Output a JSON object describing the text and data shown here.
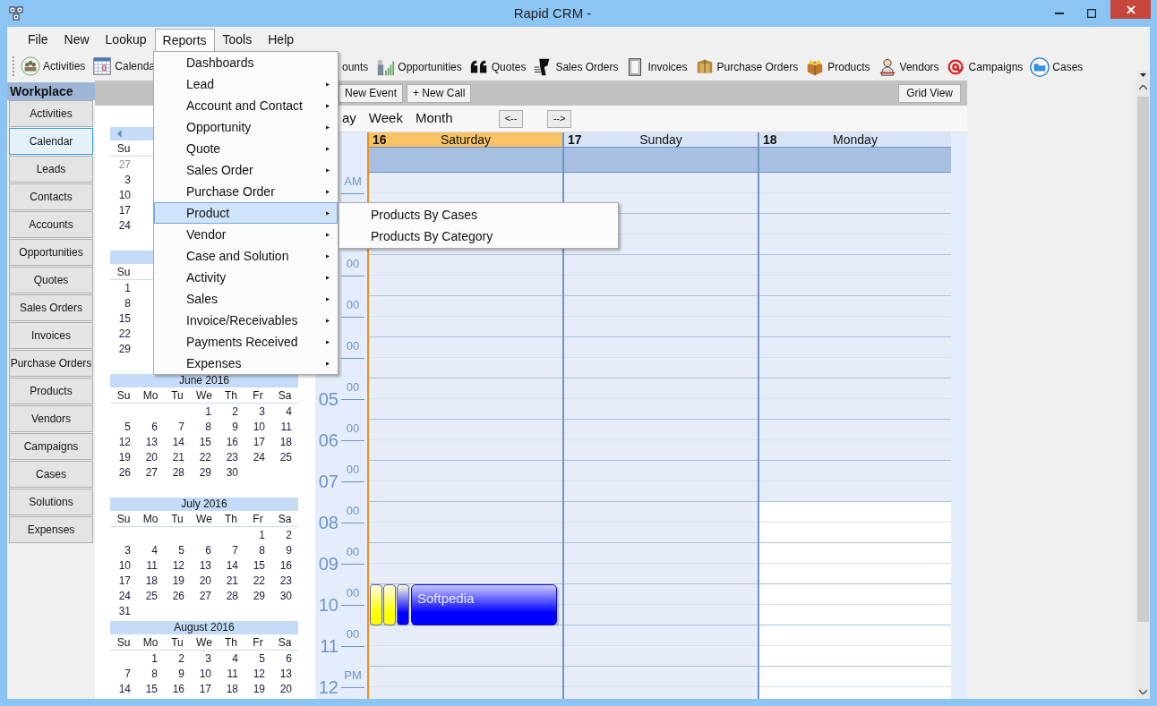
{
  "window": {
    "title": "Rapid CRM -"
  },
  "menu_bar": [
    {
      "label": "File",
      "selected": false
    },
    {
      "label": "New",
      "selected": false
    },
    {
      "label": "Lookup",
      "selected": false
    },
    {
      "label": "Reports",
      "selected": true
    },
    {
      "label": "Tools",
      "selected": false
    },
    {
      "label": "Help",
      "selected": false
    }
  ],
  "toolbar_left": [
    {
      "label": "Activities"
    },
    {
      "label": "Calenda"
    }
  ],
  "toolbar_right": [
    {
      "label": "ounts"
    },
    {
      "label": "Opportunities"
    },
    {
      "label": "Quotes"
    },
    {
      "label": "Sales Orders"
    },
    {
      "label": "Invoices"
    },
    {
      "label": "Purchase Orders"
    },
    {
      "label": "Products"
    },
    {
      "label": "Vendors"
    },
    {
      "label": "Campaigns"
    },
    {
      "label": "Cases"
    }
  ],
  "workplace": {
    "title": "Workplace",
    "items": [
      {
        "label": "Activities",
        "selected": false
      },
      {
        "label": "Calendar",
        "selected": true
      },
      {
        "label": "Leads",
        "selected": false
      },
      {
        "label": "Contacts",
        "selected": false
      },
      {
        "label": "Accounts",
        "selected": false
      },
      {
        "label": "Opportunities",
        "selected": false
      },
      {
        "label": "Quotes",
        "selected": false
      },
      {
        "label": "Sales Orders",
        "selected": false
      },
      {
        "label": "Invoices",
        "selected": false
      },
      {
        "label": "Purchase Orders",
        "selected": false
      },
      {
        "label": "Products",
        "selected": false
      },
      {
        "label": "Vendors",
        "selected": false
      },
      {
        "label": "Campaigns",
        "selected": false
      },
      {
        "label": "Cases",
        "selected": false
      },
      {
        "label": "Solutions",
        "selected": false
      },
      {
        "label": "Expenses",
        "selected": false
      }
    ]
  },
  "calendar_toolbar": {
    "buttons": [
      "New Event",
      "+ New Call"
    ],
    "grid_view": "Grid View"
  },
  "view_tabs": [
    "ay",
    "Week",
    "Month"
  ],
  "nav_buttons": [
    "<--",
    "-->"
  ],
  "mini_calendars": [
    {
      "prev_arrow": true,
      "weekdays": [
        "Su"
      ],
      "weeks": [
        [
          {
            "day": "27",
            "faded": true
          }
        ],
        [
          "3"
        ],
        [
          "10"
        ],
        [
          "17"
        ],
        [
          "24"
        ]
      ]
    },
    {
      "prev_arrow": false,
      "weekdays": [
        "Su"
      ],
      "weeks": [
        [
          "1"
        ],
        [
          "8"
        ],
        [
          "15"
        ],
        [
          "22"
        ],
        [
          "29"
        ]
      ]
    },
    {
      "prev_arrow": false,
      "title": "June 2016",
      "weekdays": [
        "Su",
        "Mo",
        "Tu",
        "We",
        "Th",
        "Fr",
        "Sa"
      ],
      "weeks": [
        [
          "1",
          "2",
          "3",
          "4"
        ],
        [
          "5",
          "6",
          "7",
          "8",
          "9",
          "10",
          "11"
        ],
        [
          "12",
          "13",
          "14",
          "15",
          "16",
          "17",
          "18"
        ],
        [
          "19",
          "20",
          "21",
          "22",
          "23",
          "24",
          "25"
        ],
        [
          "26",
          "27",
          "28",
          "29",
          "30"
        ]
      ]
    },
    {
      "prev_arrow": false,
      "title": "July 2016",
      "weekdays": [
        "Su",
        "Mo",
        "Tu",
        "We",
        "Th",
        "Fr",
        "Sa"
      ],
      "weeks": [
        [
          "1",
          "2"
        ],
        [
          "3",
          "4",
          "5",
          "6",
          "7",
          "8",
          "9"
        ],
        [
          "10",
          "11",
          "12",
          "13",
          "14",
          "15",
          "16"
        ],
        [
          "17",
          "18",
          "19",
          "20",
          "21",
          "22",
          "23"
        ],
        [
          "24",
          "25",
          "26",
          "27",
          "28",
          "29",
          "30"
        ],
        [
          "31"
        ]
      ]
    },
    {
      "prev_arrow": false,
      "title": "August 2016",
      "weekdays": [
        "Su",
        "Mo",
        "Tu",
        "We",
        "Th",
        "Fr",
        "Sa"
      ],
      "weeks": [
        [
          "1",
          "2",
          "3",
          "4",
          "5",
          "6"
        ],
        [
          "7",
          "8",
          "9",
          "10",
          "11",
          "12",
          "13"
        ],
        [
          "14",
          "15",
          "16",
          "17",
          "18",
          "19",
          "20"
        ]
      ]
    }
  ],
  "days": [
    {
      "number": "16",
      "name": "Saturday",
      "selected": true,
      "weekend": true
    },
    {
      "number": "17",
      "name": "Sunday",
      "selected": false,
      "weekend": true
    },
    {
      "number": "18",
      "name": "Monday",
      "selected": false,
      "weekend": false
    }
  ],
  "time_rows": [
    {
      "minor": "AM",
      "work": false
    },
    {
      "work": false
    },
    {
      "minor": "00",
      "work": false
    },
    {
      "minor": "00",
      "work": false
    },
    {
      "minor": "00",
      "work": false
    },
    {
      "hour": "05",
      "minor": "00",
      "work": false
    },
    {
      "hour": "06",
      "minor": "00",
      "work": false
    },
    {
      "hour": "07",
      "minor": "00",
      "work": false
    },
    {
      "hour": "08",
      "minor": "00",
      "work": true
    },
    {
      "hour": "09",
      "minor": "00",
      "work": true
    },
    {
      "hour": "10",
      "minor": "00",
      "work": true,
      "cells": [
        {
          "events": [
            {
              "kind": "marker",
              "color": "#ffff00"
            },
            {
              "kind": "marker",
              "color": "#ffff00"
            },
            {
              "kind": "marker",
              "color": "#0000ff"
            },
            {
              "kind": "appointment",
              "title": "Softpedia",
              "color": "#0000ff"
            }
          ]
        }
      ]
    },
    {
      "hour": "11",
      "minor": "00",
      "work": true
    },
    {
      "hour": "12",
      "minor": "PM",
      "work": true
    }
  ],
  "reports_menu": {
    "items": [
      {
        "label": "Dashboards",
        "submenu": false,
        "selected": false
      },
      {
        "label": "Lead",
        "submenu": true,
        "selected": false
      },
      {
        "label": "Account and Contact",
        "submenu": true,
        "selected": false
      },
      {
        "label": "Opportunity",
        "submenu": true,
        "selected": false
      },
      {
        "label": "Quote",
        "submenu": true,
        "selected": false
      },
      {
        "label": "Sales Order",
        "submenu": true,
        "selected": false
      },
      {
        "label": "Purchase Order",
        "submenu": true,
        "selected": false
      },
      {
        "label": "Product",
        "submenu": true,
        "selected": true
      },
      {
        "label": "Vendor",
        "submenu": true,
        "selected": false
      },
      {
        "label": "Case and Solution",
        "submenu": true,
        "selected": false
      },
      {
        "label": "Activity",
        "submenu": true,
        "selected": false
      },
      {
        "label": "Sales",
        "submenu": true,
        "selected": false
      },
      {
        "label": "Invoice/Receivables",
        "submenu": true,
        "selected": false
      },
      {
        "label": "Payments Received",
        "submenu": true,
        "selected": false
      },
      {
        "label": "Expenses",
        "submenu": true,
        "selected": false
      }
    ],
    "submenu": [
      "Products By Cases",
      "Products By Category"
    ]
  }
}
